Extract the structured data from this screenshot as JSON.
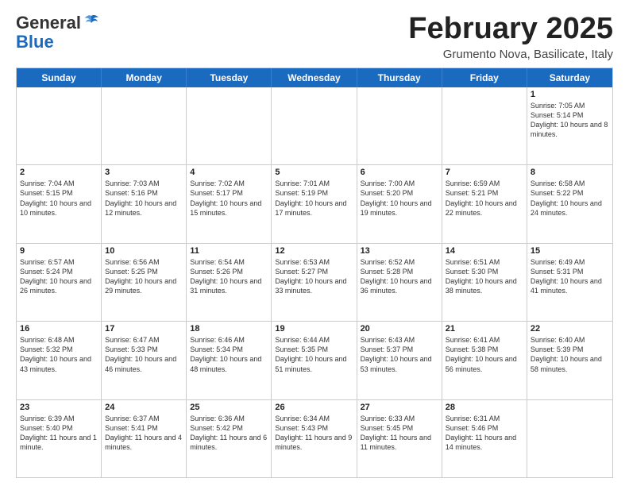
{
  "logo": {
    "general": "General",
    "blue": "Blue"
  },
  "header": {
    "title": "February 2025",
    "subtitle": "Grumento Nova, Basilicate, Italy"
  },
  "days": [
    "Sunday",
    "Monday",
    "Tuesday",
    "Wednesday",
    "Thursday",
    "Friday",
    "Saturday"
  ],
  "weeks": [
    [
      {
        "day": "",
        "text": ""
      },
      {
        "day": "",
        "text": ""
      },
      {
        "day": "",
        "text": ""
      },
      {
        "day": "",
        "text": ""
      },
      {
        "day": "",
        "text": ""
      },
      {
        "day": "",
        "text": ""
      },
      {
        "day": "1",
        "text": "Sunrise: 7:05 AM\nSunset: 5:14 PM\nDaylight: 10 hours and 8 minutes."
      }
    ],
    [
      {
        "day": "2",
        "text": "Sunrise: 7:04 AM\nSunset: 5:15 PM\nDaylight: 10 hours and 10 minutes."
      },
      {
        "day": "3",
        "text": "Sunrise: 7:03 AM\nSunset: 5:16 PM\nDaylight: 10 hours and 12 minutes."
      },
      {
        "day": "4",
        "text": "Sunrise: 7:02 AM\nSunset: 5:17 PM\nDaylight: 10 hours and 15 minutes."
      },
      {
        "day": "5",
        "text": "Sunrise: 7:01 AM\nSunset: 5:19 PM\nDaylight: 10 hours and 17 minutes."
      },
      {
        "day": "6",
        "text": "Sunrise: 7:00 AM\nSunset: 5:20 PM\nDaylight: 10 hours and 19 minutes."
      },
      {
        "day": "7",
        "text": "Sunrise: 6:59 AM\nSunset: 5:21 PM\nDaylight: 10 hours and 22 minutes."
      },
      {
        "day": "8",
        "text": "Sunrise: 6:58 AM\nSunset: 5:22 PM\nDaylight: 10 hours and 24 minutes."
      }
    ],
    [
      {
        "day": "9",
        "text": "Sunrise: 6:57 AM\nSunset: 5:24 PM\nDaylight: 10 hours and 26 minutes."
      },
      {
        "day": "10",
        "text": "Sunrise: 6:56 AM\nSunset: 5:25 PM\nDaylight: 10 hours and 29 minutes."
      },
      {
        "day": "11",
        "text": "Sunrise: 6:54 AM\nSunset: 5:26 PM\nDaylight: 10 hours and 31 minutes."
      },
      {
        "day": "12",
        "text": "Sunrise: 6:53 AM\nSunset: 5:27 PM\nDaylight: 10 hours and 33 minutes."
      },
      {
        "day": "13",
        "text": "Sunrise: 6:52 AM\nSunset: 5:28 PM\nDaylight: 10 hours and 36 minutes."
      },
      {
        "day": "14",
        "text": "Sunrise: 6:51 AM\nSunset: 5:30 PM\nDaylight: 10 hours and 38 minutes."
      },
      {
        "day": "15",
        "text": "Sunrise: 6:49 AM\nSunset: 5:31 PM\nDaylight: 10 hours and 41 minutes."
      }
    ],
    [
      {
        "day": "16",
        "text": "Sunrise: 6:48 AM\nSunset: 5:32 PM\nDaylight: 10 hours and 43 minutes."
      },
      {
        "day": "17",
        "text": "Sunrise: 6:47 AM\nSunset: 5:33 PM\nDaylight: 10 hours and 46 minutes."
      },
      {
        "day": "18",
        "text": "Sunrise: 6:46 AM\nSunset: 5:34 PM\nDaylight: 10 hours and 48 minutes."
      },
      {
        "day": "19",
        "text": "Sunrise: 6:44 AM\nSunset: 5:35 PM\nDaylight: 10 hours and 51 minutes."
      },
      {
        "day": "20",
        "text": "Sunrise: 6:43 AM\nSunset: 5:37 PM\nDaylight: 10 hours and 53 minutes."
      },
      {
        "day": "21",
        "text": "Sunrise: 6:41 AM\nSunset: 5:38 PM\nDaylight: 10 hours and 56 minutes."
      },
      {
        "day": "22",
        "text": "Sunrise: 6:40 AM\nSunset: 5:39 PM\nDaylight: 10 hours and 58 minutes."
      }
    ],
    [
      {
        "day": "23",
        "text": "Sunrise: 6:39 AM\nSunset: 5:40 PM\nDaylight: 11 hours and 1 minute."
      },
      {
        "day": "24",
        "text": "Sunrise: 6:37 AM\nSunset: 5:41 PM\nDaylight: 11 hours and 4 minutes."
      },
      {
        "day": "25",
        "text": "Sunrise: 6:36 AM\nSunset: 5:42 PM\nDaylight: 11 hours and 6 minutes."
      },
      {
        "day": "26",
        "text": "Sunrise: 6:34 AM\nSunset: 5:43 PM\nDaylight: 11 hours and 9 minutes."
      },
      {
        "day": "27",
        "text": "Sunrise: 6:33 AM\nSunset: 5:45 PM\nDaylight: 11 hours and 11 minutes."
      },
      {
        "day": "28",
        "text": "Sunrise: 6:31 AM\nSunset: 5:46 PM\nDaylight: 11 hours and 14 minutes."
      },
      {
        "day": "",
        "text": ""
      }
    ]
  ]
}
